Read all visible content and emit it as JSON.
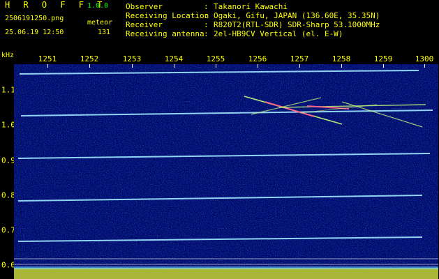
{
  "header": {
    "app_title": "H R O F F T",
    "app_version": "1.0.0",
    "filename": "2506191250.png",
    "mode": "meteor",
    "datetime": "25.06.19 12:50",
    "count": "131",
    "info": [
      {
        "label": "Observer",
        "value": "Takanori Kawachi"
      },
      {
        "label": "Receiving Location",
        "value": "Ogaki, Gifu, JAPAN (136.60E, 35.35N)"
      },
      {
        "label": "Receiver",
        "value": "R820T2(RTL-SDR) SDR-Sharp 53.1000MHz"
      },
      {
        "label": "Receiving antenna",
        "value": "2el-HB9CV Vertical (el. E-W)"
      }
    ],
    "colon": ":"
  },
  "axis": {
    "unit": "kHz",
    "time_ticks": [
      "1251",
      "1252",
      "1253",
      "1254",
      "1255",
      "1256",
      "1257",
      "1258",
      "1259",
      "1300"
    ],
    "freq_ticks": [
      "1.1",
      "1.0",
      "0.9",
      "0.8",
      "0.7",
      "0.6"
    ]
  },
  "colors": {
    "text": "#ffff00",
    "version": "#00ff00",
    "background": "#000a6e",
    "carrier": "#9fe8ff"
  }
}
